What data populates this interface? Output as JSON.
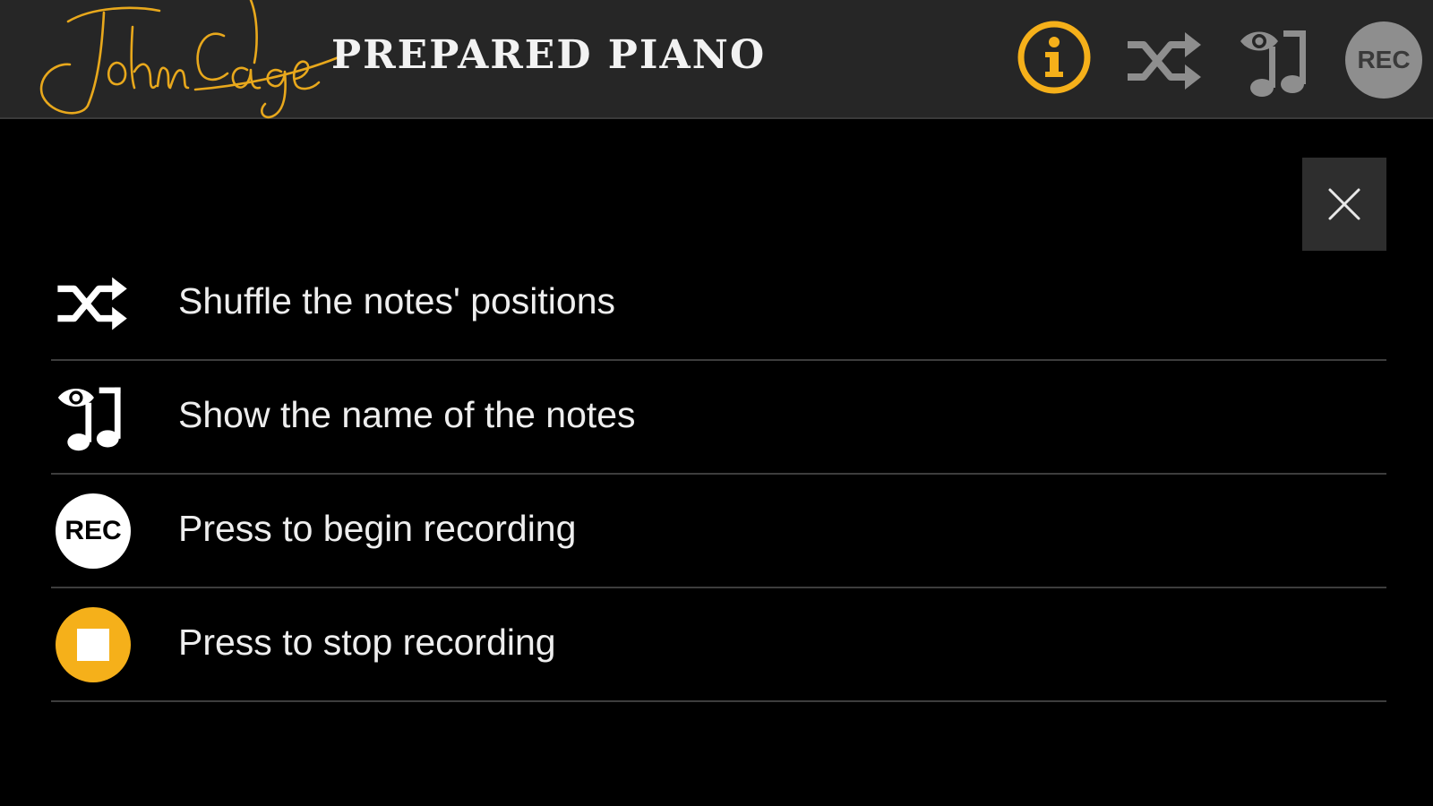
{
  "header": {
    "signature_text": "John Cage",
    "title": "PREPARED PIANO",
    "info_icon": "info-icon",
    "shuffle_icon": "shuffle-icon",
    "show_names_icon": "eye-music-note-icon",
    "rec_label": "REC"
  },
  "colors": {
    "accent": "#f5b01a",
    "topbar_bg": "#262626",
    "background": "#000000",
    "inactive_icon": "#8e8e8e",
    "divider": "#3d3d3d",
    "close_bg": "#2e2e2e"
  },
  "dialog": {
    "close_icon": "close-icon",
    "items": [
      {
        "icon": "shuffle-icon",
        "label": "Shuffle the notes' positions"
      },
      {
        "icon": "eye-music-note-icon",
        "label": "Show the name of the notes"
      },
      {
        "icon": "rec-icon",
        "icon_text": "REC",
        "label": "Press to begin recording"
      },
      {
        "icon": "stop-icon",
        "label": "Press to stop recording"
      }
    ]
  }
}
